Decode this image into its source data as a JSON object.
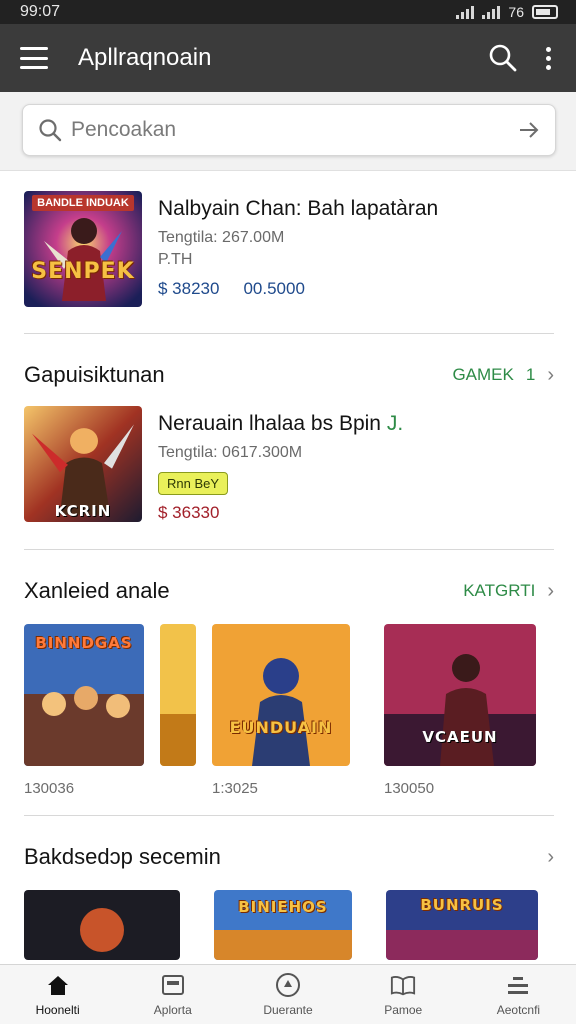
{
  "status_bar": {
    "time": "99:07",
    "battery_text": "76"
  },
  "app_bar": {
    "title": "Apllraqnoain"
  },
  "search": {
    "placeholder": "Pencoakan"
  },
  "featured": {
    "title": "Nalbyain Chan: Bah lapatàran",
    "meta_line1": "Tengtila: 267.00M",
    "meta_line2": "P.TH",
    "price_primary": "$ 38230",
    "price_secondary": "00.5000",
    "thumb_banner": "BANDLE INDUAK",
    "thumb_logo": "SENPEK"
  },
  "section1": {
    "title": "Gapuisiktunan",
    "link": "GAMEK",
    "link_badge": "1",
    "app": {
      "title": "Nerauain lhalaa bs Bpin",
      "title_mark": "J.",
      "meta": "Tengtila: 0617.300M",
      "badge": "Rnn BeY",
      "price": "$ 36330",
      "thumb_logo": "KCRIN"
    }
  },
  "section2": {
    "title": "Xanleied anale",
    "link": "KATGRTI",
    "tiles": [
      {
        "caption": "130036",
        "logo": "BINNDGAS"
      },
      {
        "caption": "",
        "logo": ""
      },
      {
        "caption": "1:3025",
        "logo": "EUNDUAIN"
      },
      {
        "caption": "130050",
        "logo": "VCAEUN"
      }
    ]
  },
  "section3": {
    "title": "Bakdsedɔp secemin",
    "tiles": [
      {
        "logo": ""
      },
      {
        "logo": "BINIEHOS"
      },
      {
        "logo": "BUNRUIS"
      }
    ]
  },
  "bottom_nav": [
    {
      "label": "Hoonelti",
      "icon": "home-icon"
    },
    {
      "label": "Aplorta",
      "icon": "apps-icon"
    },
    {
      "label": "Duerante",
      "icon": "compass-icon"
    },
    {
      "label": "Pamoe",
      "icon": "book-icon"
    },
    {
      "label": "Aeotcnfi",
      "icon": "account-icon"
    }
  ],
  "colors": {
    "app_bar": "#3b3b3b",
    "status_bar": "#222222",
    "link_green": "#2e8b47",
    "price_blue": "#1f4a8c",
    "price_red": "#a2202a"
  }
}
